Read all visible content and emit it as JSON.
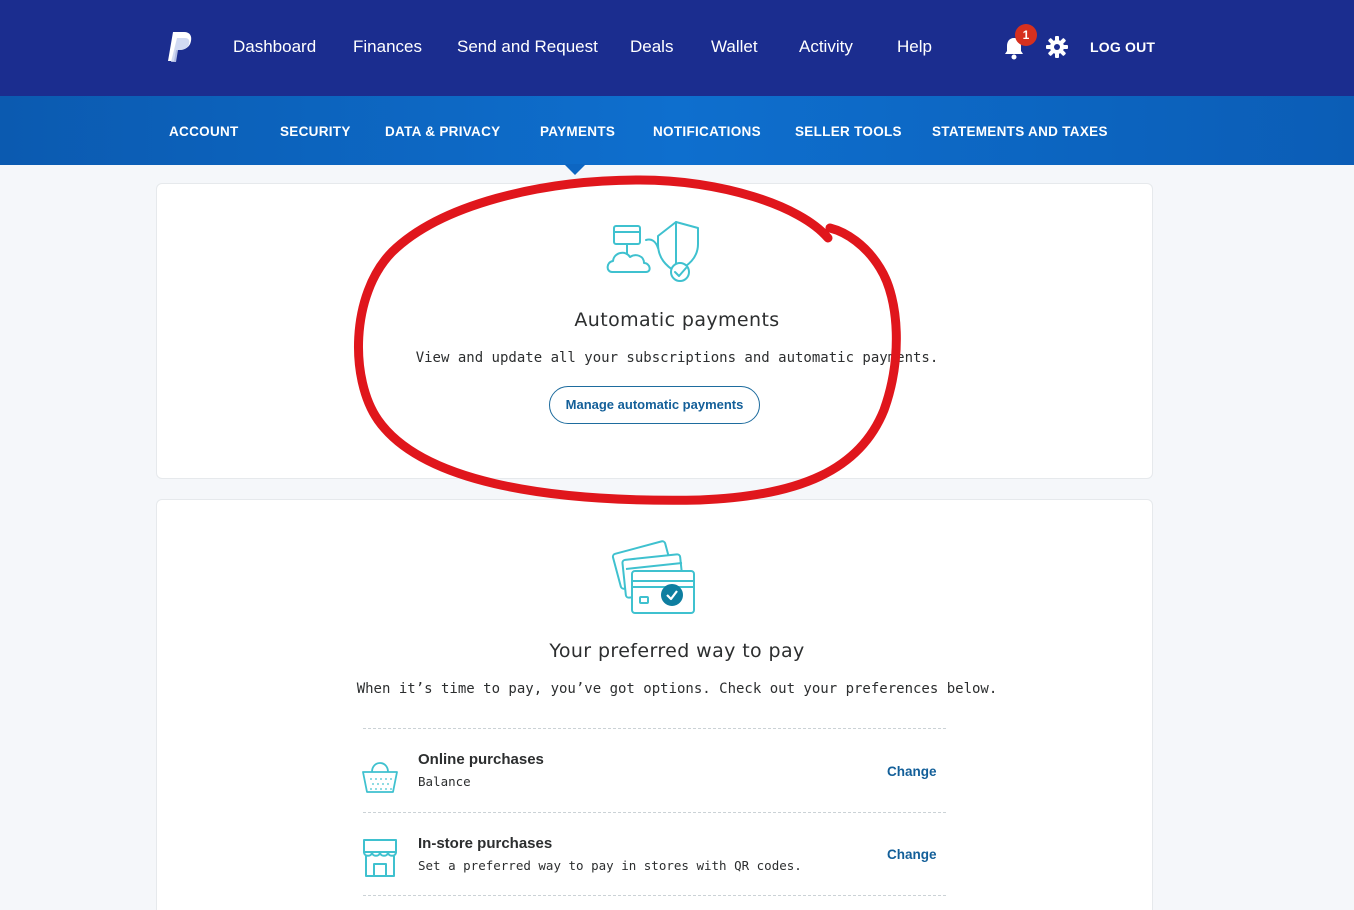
{
  "top_nav": {
    "items": [
      {
        "label": "Dashboard"
      },
      {
        "label": "Finances"
      },
      {
        "label": "Send and Request"
      },
      {
        "label": "Deals"
      },
      {
        "label": "Wallet"
      },
      {
        "label": "Activity"
      },
      {
        "label": "Help"
      }
    ],
    "notification_count": "1",
    "logout_label": "LOG OUT"
  },
  "sub_nav": {
    "items": [
      {
        "label": "ACCOUNT"
      },
      {
        "label": "SECURITY"
      },
      {
        "label": "DATA & PRIVACY"
      },
      {
        "label": "PAYMENTS"
      },
      {
        "label": "NOTIFICATIONS"
      },
      {
        "label": "SELLER TOOLS"
      },
      {
        "label": "STATEMENTS AND TAXES"
      }
    ],
    "active": "PAYMENTS"
  },
  "auto_payments": {
    "title": "Automatic payments",
    "description": "View and update all your subscriptions and automatic payments.",
    "button_label": "Manage automatic payments"
  },
  "preferred_pay": {
    "title": "Your preferred way to pay",
    "description": "When it’s time to pay, you’ve got options. Check out your preferences below.",
    "rows": [
      {
        "title": "Online purchases",
        "subtitle": "Balance",
        "action": "Change"
      },
      {
        "title": "In-store purchases",
        "subtitle": "Set a preferred way to pay in stores with QR codes.",
        "action": "Change"
      }
    ]
  },
  "colors": {
    "top_nav_bg": "#1b2d8f",
    "sub_nav_bg": "#0d64c0",
    "link_blue": "#135f99",
    "illustration_teal": "#3fc1cf",
    "annotation_red": "#e0161c",
    "badge_red": "#d6301f"
  },
  "icons": [
    "paypal-logo-icon",
    "bell-icon",
    "gear-icon",
    "cloud-shield-icon",
    "cards-check-icon",
    "basket-icon",
    "storefront-icon"
  ]
}
